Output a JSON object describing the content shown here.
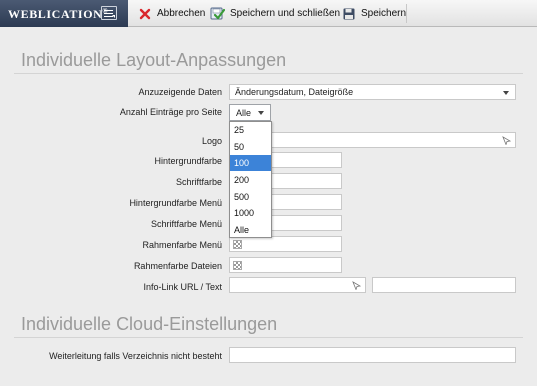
{
  "toolbar": {
    "brand": "WEBLICATION",
    "brand_reg": "®",
    "cancel_label": "Abbrechen",
    "save_close_label": "Speichern und schließen",
    "save_label": "Speichern",
    "colors": {
      "cancel_x": "#d9262c",
      "brand_bg": "#34425a",
      "save_check": "#3a9a3a"
    }
  },
  "layout_section": {
    "title": "Individuelle Layout-Anpassungen",
    "rows": {
      "display_data": {
        "label": "Anzuzeigende Daten",
        "value": "Änderungsdatum, Dateigröße"
      },
      "entries_per_page": {
        "label": "Anzahl Einträge pro Seite",
        "value": "Alle"
      },
      "logo": {
        "label": "Logo"
      },
      "bg_color": {
        "label": "Hintergrundfarbe"
      },
      "font_color": {
        "label": "Schriftfarbe"
      },
      "menu_bg_color": {
        "label": "Hintergrundfarbe Menü"
      },
      "menu_font_color": {
        "label": "Schriftfarbe Menü"
      },
      "menu_border_color": {
        "label": "Rahmenfarbe Menü"
      },
      "files_border_color": {
        "label": "Rahmenfarbe Dateien"
      },
      "info_link": {
        "label": "Info-Link URL / Text"
      }
    },
    "entries_dropdown": {
      "options": [
        "25",
        "50",
        "100",
        "200",
        "500",
        "1000",
        "Alle"
      ],
      "highlighted": "100"
    }
  },
  "cloud_section": {
    "title": "Individuelle Cloud-Einstellungen",
    "rows": {
      "redirect": {
        "label": "Weiterleitung falls Verzeichnis nicht besteht"
      }
    }
  }
}
